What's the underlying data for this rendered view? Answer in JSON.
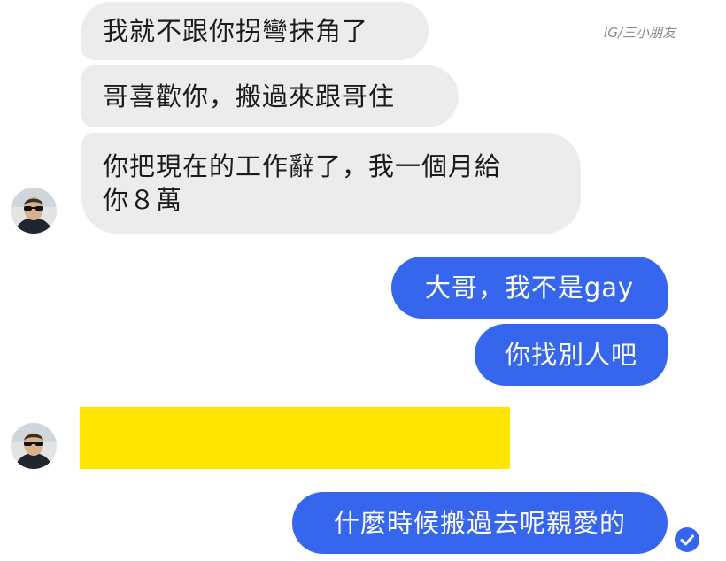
{
  "watermark": "IG/三小朋友",
  "colors": {
    "incoming_bubble": "#ececec",
    "outgoing_bubble": "#3766ee",
    "redaction": "#ffe600",
    "read_receipt": "#3766ee"
  },
  "messages": {
    "incoming_1": "我就不跟你拐彎抹角了",
    "incoming_2": "哥喜歡你，搬過來跟哥住",
    "incoming_3": "你把現在的工作辭了，我一個月給\n你８萬",
    "outgoing_1": "大哥，我不是gay",
    "outgoing_2": "你找別人吧",
    "outgoing_3": "什麼時候搬過去呢親愛的"
  },
  "icons": {
    "read_receipt": "check-circle-icon",
    "avatar": "sender-avatar"
  }
}
